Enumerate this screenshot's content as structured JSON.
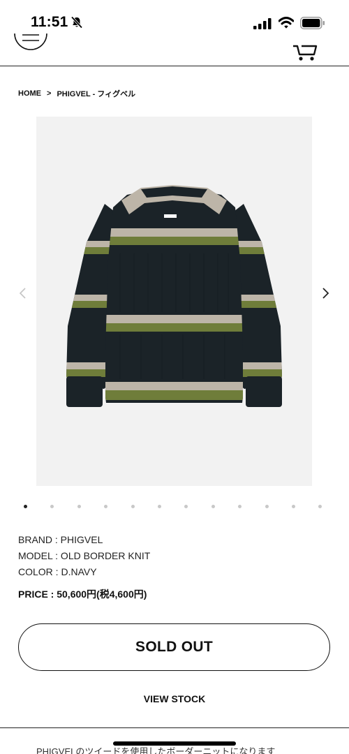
{
  "status_bar": {
    "time": "11:51"
  },
  "breadcrumb": {
    "home": "HOME",
    "separator": ">",
    "current": "PHIGVEL - フィグベル"
  },
  "gallery": {
    "dot_count": 12,
    "active_index": 0
  },
  "product": {
    "brand": "BRAND : PHIGVEL",
    "model": "MODEL : OLD BORDER KNIT",
    "color": "COLOR : D.NAVY",
    "price": "PRICE : 50,600円(税4,600円)"
  },
  "actions": {
    "sold_out_label": "SOLD OUT",
    "view_stock_label": "VIEW STOCK"
  },
  "description": {
    "text": "PHIGVELのツイードを使用したボーダーニットになります"
  },
  "icons": {
    "menu": "hamburger-menu-icon",
    "cart": "cart-icon",
    "bell": "bell-slash-icon",
    "signal": "cellular-signal-icon",
    "wifi": "wifi-icon",
    "battery": "battery-icon",
    "prev": "chevron-left-icon",
    "next": "chevron-right-icon"
  },
  "colors": {
    "sweater_navy": "#1b2328",
    "stripe_green": "#6f7d3a",
    "stripe_oatmeal": "#bdb5a8",
    "image_background": "#f2f2f2"
  }
}
